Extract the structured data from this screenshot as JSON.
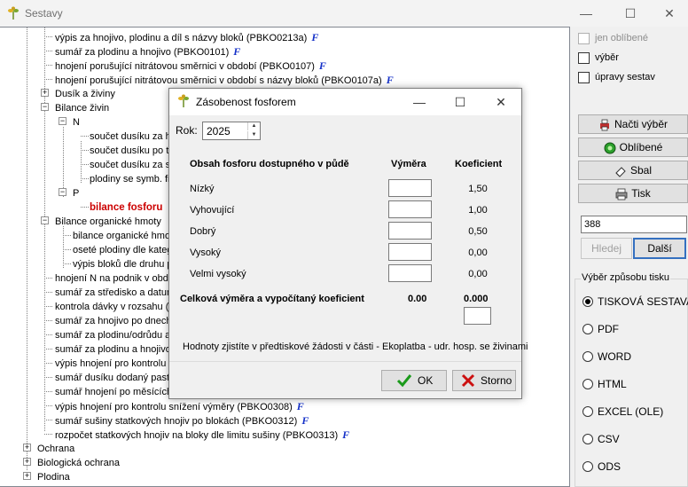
{
  "window": {
    "title": "Sestavy"
  },
  "tree": {
    "items": [
      {
        "label": "výpis za hnojivo, plodinu a díl s názvy bloků (PBKO0213a)",
        "f": "F"
      },
      {
        "label": "sumář za plodinu a hnojivo (PBKO0101)",
        "f": "F"
      },
      {
        "label": "hnojení porušující nitrátovou směrnici v období  (PBKO0107)",
        "f": "F"
      },
      {
        "label": "hnojení porušující nitrátovou směrnici v období s názvy bloků (PBKO0107a)",
        "f": "F"
      },
      {
        "label": "Dusík a živiny"
      },
      {
        "label": "Bilance živin"
      },
      {
        "label": "N"
      },
      {
        "label": "součet dusíku za h"
      },
      {
        "label": "součet dusíku po t"
      },
      {
        "label": "součet dusíku za s"
      },
      {
        "label": "plodiny se symb. fix"
      },
      {
        "label": "P"
      },
      {
        "label": "bilance fosforu"
      },
      {
        "label": "Bilance organické hmoty"
      },
      {
        "label": "bilance organické hmo"
      },
      {
        "label": "oseté plodiny dle kateg"
      },
      {
        "label": "výpis bloků dle druhu p"
      },
      {
        "label": "hnojení N na podnik v obd"
      },
      {
        "label": "sumář za středisko a datun"
      },
      {
        "label": "kontrola dávky v rozsahu ("
      },
      {
        "label": "sumář za hnojivo po dnech"
      },
      {
        "label": "sumář za plodinu/odrůdu a"
      },
      {
        "label": "sumář za plodinu a hnojivo"
      },
      {
        "label": "výpis hnojení pro kontrolu c"
      },
      {
        "label": "sumář dusíku dodaný pasty"
      },
      {
        "label": "sumář hnojení po měsících"
      },
      {
        "label": "výpis hnojení pro kontrolu snížení výměry (PBKO0308)",
        "f": "F"
      },
      {
        "label": "sumář sušiny statkových hnojiv po blokách (PBKO0312)",
        "f": "F"
      },
      {
        "label": "rozpočet statkových hnojiv na bloky dle limitu sušiny (PBKO0313)",
        "f": "F"
      },
      {
        "label": "Ochrana"
      },
      {
        "label": "Biologická ochrana"
      },
      {
        "label": "Plodina"
      }
    ]
  },
  "filters": {
    "only_favorites": "jen oblíbené",
    "selection": "výběr",
    "edit_reports": "úpravy sestav"
  },
  "buttons": {
    "load_selection": "Načti výběr",
    "favorites": "Oblíbené",
    "collapse": "Sbal",
    "print": "Tisk"
  },
  "search": {
    "value": "388",
    "find": "Hledej",
    "next": "Další"
  },
  "print_mode": {
    "legend": "Výběr způsobu tisku",
    "options": [
      "TISKOVÁ SESTAVA",
      "PDF",
      "WORD",
      "HTML",
      "EXCEL (OLE)",
      "CSV",
      "ODS"
    ],
    "selected": 0
  },
  "dialog": {
    "title": "Zásobenost fosforem",
    "year_label": "Rok:",
    "year_value": "2025",
    "col_content": "Obsah fosforu dostupného v půdě",
    "col_area": "Výměra",
    "col_coef": "Koeficient",
    "rows": [
      {
        "label": "Nízký",
        "coef": "1,50"
      },
      {
        "label": "Vyhovující",
        "coef": "1,00"
      },
      {
        "label": "Dobrý",
        "coef": "0,50"
      },
      {
        "label": "Vysoký",
        "coef": "0,00"
      },
      {
        "label": "Velmi vysoký",
        "coef": "0,00"
      }
    ],
    "total_label": "Celková výměra a vypočítaný koeficient",
    "total_area": "0.00",
    "total_coef": "0.000",
    "hint": "Hodnoty zjistíte v předtiskové žádosti v části - Ekoplatba - udr. hosp. se živinami",
    "ok": "OK",
    "cancel": "Storno"
  }
}
